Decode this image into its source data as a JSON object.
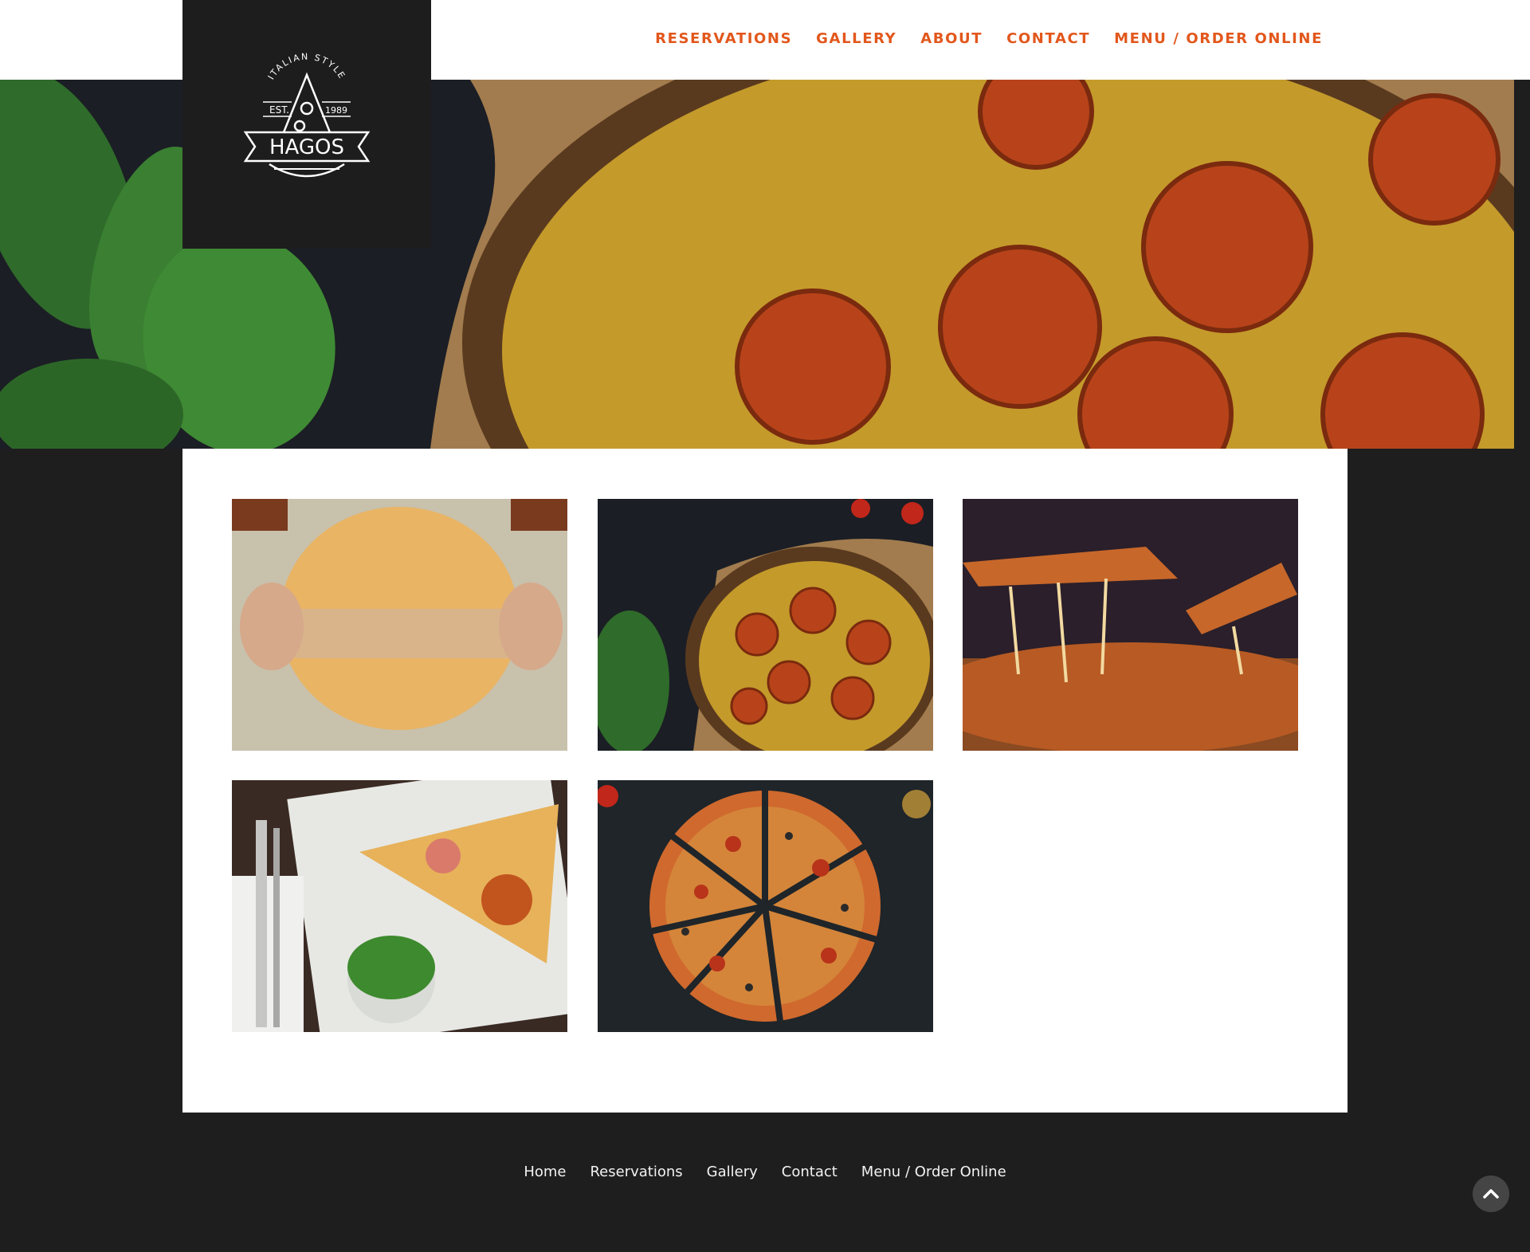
{
  "header": {
    "logo": {
      "arc_text": "ITALIAN STYLE",
      "est": "EST.",
      "year": "1989",
      "name": "HAGOS"
    },
    "nav": [
      {
        "label": "RESERVATIONS"
      },
      {
        "label": "GALLERY"
      },
      {
        "label": "ABOUT"
      },
      {
        "label": "CONTACT"
      },
      {
        "label": "MENU / ORDER ONLINE"
      }
    ]
  },
  "hero": {
    "alt_icon": "pizza-hero-image"
  },
  "gallery": {
    "images": [
      {
        "name": "dough-rolling-image"
      },
      {
        "name": "tomato-pie-image"
      },
      {
        "name": "cheese-pull-image"
      },
      {
        "name": "pizza-slice-plate-image"
      },
      {
        "name": "sliced-pizza-image"
      }
    ]
  },
  "footer": {
    "nav": [
      {
        "label": "Home"
      },
      {
        "label": "Reservations"
      },
      {
        "label": "Gallery"
      },
      {
        "label": "Contact"
      },
      {
        "label": "Menu / Order Online"
      }
    ],
    "to_top_icon": "chevron-up-icon"
  },
  "colors": {
    "accent": "#e2571c",
    "dark": "#1e1e1e",
    "white": "#ffffff"
  }
}
